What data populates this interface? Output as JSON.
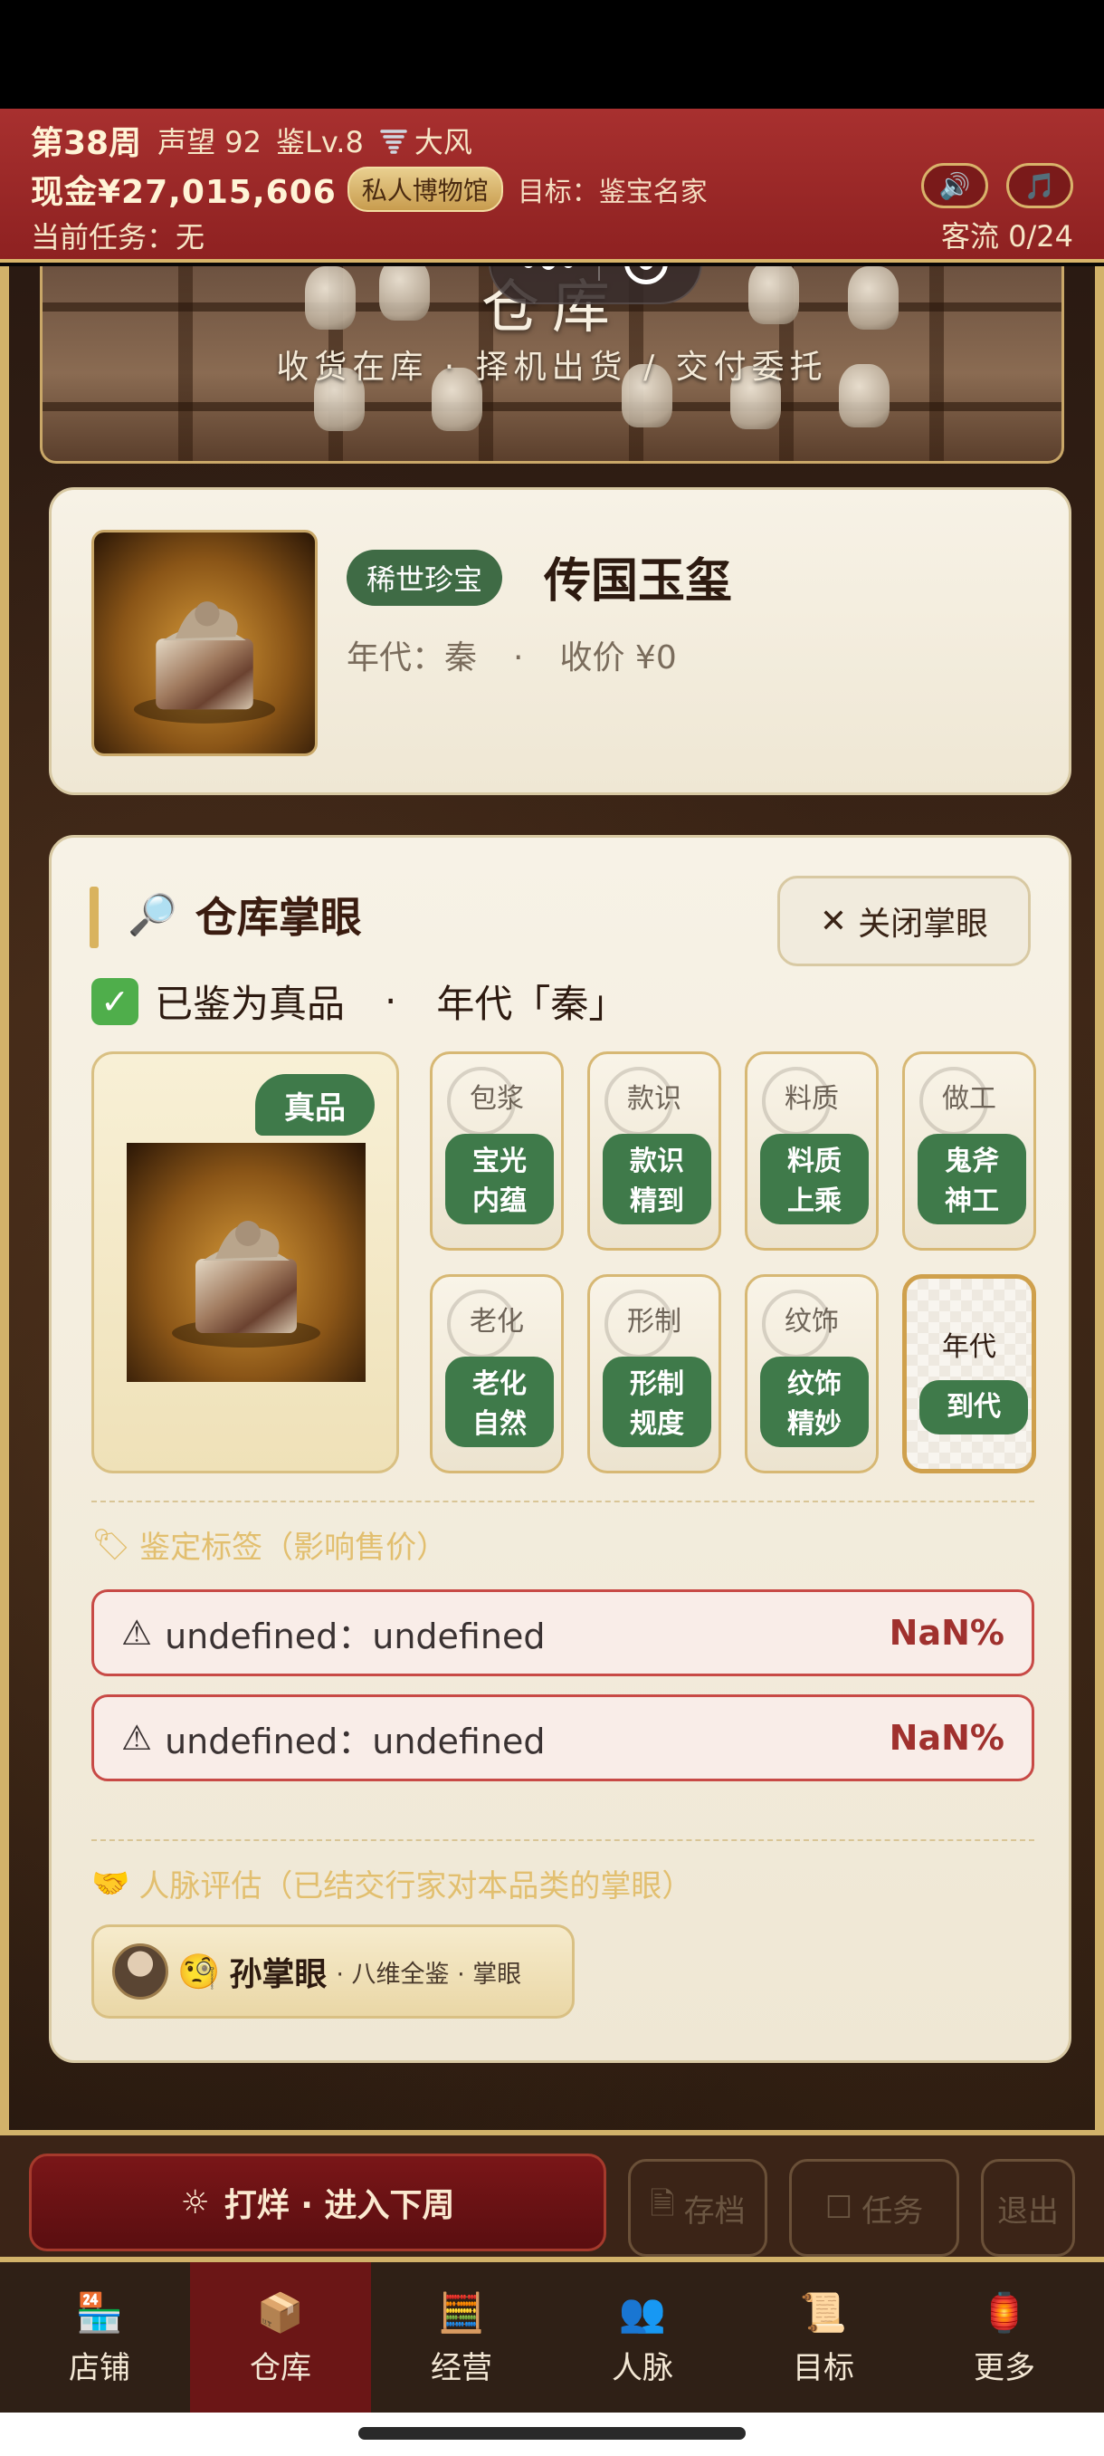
{
  "header": {
    "week": "第38周",
    "reputation": "声望 92",
    "level": "鉴Lv.8",
    "weather_icon": "tornado-icon",
    "weather": "大风",
    "cash": "现金¥27,015,606",
    "museum_badge": "私人博物馆",
    "goal": "目标：鉴宝名家",
    "task": "当前任务：无",
    "sound_icon": "speaker-icon",
    "music_icon": "music-note-icon",
    "customer_flow": "客流 0/24"
  },
  "banner": {
    "title": "仓库",
    "subtitle": "收货在库 · 择机出货 / 交付委托"
  },
  "item": {
    "rarity": "稀世珍宝",
    "name": "传国玉玺",
    "era": "年代：秦",
    "dot": "·",
    "price": "收价 ¥0"
  },
  "inspect": {
    "title": "仓库掌眼",
    "close_label": "关闭掌眼",
    "verdict": "已鉴为真品",
    "verdict_dot": "·",
    "verdict_era": "年代「秦」",
    "genuine_badge": "真品",
    "attributes": [
      {
        "label": "包浆",
        "value": "宝光\n内蕴"
      },
      {
        "label": "款识",
        "value": "款识\n精到"
      },
      {
        "label": "料质",
        "value": "料质\n上乘"
      },
      {
        "label": "做工",
        "value": "鬼斧\n神工"
      },
      {
        "label": "老化",
        "value": "老化\n自然"
      },
      {
        "label": "形制",
        "value": "形制\n规度"
      },
      {
        "label": "纹饰",
        "value": "纹饰\n精妙"
      },
      {
        "label": "年代",
        "value": "到代"
      }
    ],
    "tags_heading": "鉴定标签（影响售价）",
    "tags": [
      {
        "text": "undefined：undefined",
        "pct": "NaN%"
      },
      {
        "text": "undefined：undefined",
        "pct": "NaN%"
      }
    ],
    "contacts_heading": "人脉评估（已结交行家对本品类的掌眼）",
    "contact": {
      "name": "孙掌眼",
      "desc": "· 八维全鉴 · 掌眼"
    }
  },
  "actions": {
    "primary": "打烊 · 进入下周",
    "save": "存档",
    "task": "任务",
    "quit": "退出"
  },
  "tabs": [
    {
      "label": "店铺",
      "icon": "shop-icon"
    },
    {
      "label": "仓库",
      "icon": "warehouse-icon"
    },
    {
      "label": "经营",
      "icon": "abacus-icon"
    },
    {
      "label": "人脉",
      "icon": "people-icon"
    },
    {
      "label": "目标",
      "icon": "scroll-icon"
    },
    {
      "label": "更多",
      "icon": "more-icon"
    }
  ],
  "colors": {
    "header_red": "#a8302f",
    "gold": "#d2b26a",
    "jade_green": "#3f7a4a",
    "warn_red": "#c84a46"
  }
}
